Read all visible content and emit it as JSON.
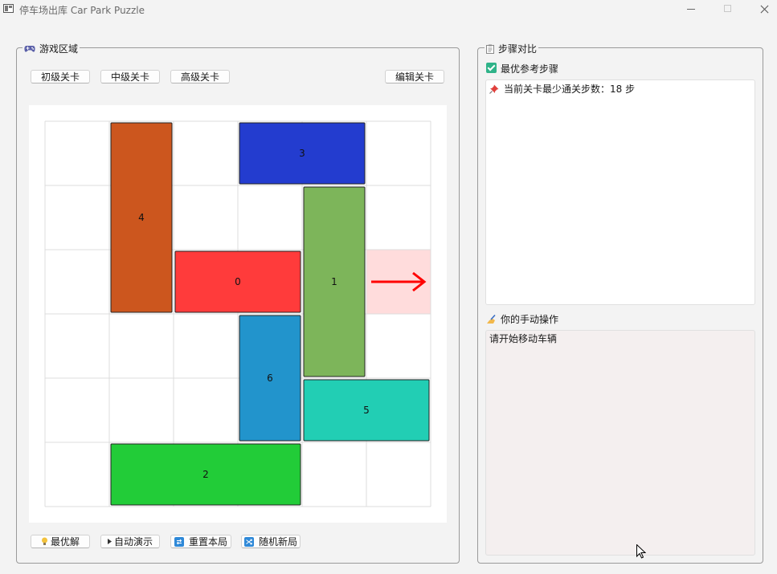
{
  "window": {
    "title": "停车场出库 Car Park Puzzle"
  },
  "game_area": {
    "title": "游戏区域",
    "icon": "gamepad-icon",
    "level_buttons": [
      "初级关卡",
      "中级关卡",
      "高级关卡"
    ],
    "edit_button": "编辑关卡",
    "board": {
      "rows": 6,
      "cols": 6,
      "exit": {
        "row": 2,
        "col": 5,
        "direction": "right",
        "color": "#ff0000",
        "highlight": "#ffdcdc"
      },
      "vehicles": [
        {
          "id": "0",
          "row": 2,
          "col": 2,
          "length": 2,
          "orientation": "horizontal",
          "color": "#ff3b3b"
        },
        {
          "id": "1",
          "row": 1,
          "col": 4,
          "length": 3,
          "orientation": "vertical",
          "color": "#7db55a"
        },
        {
          "id": "2",
          "row": 5,
          "col": 1,
          "length": 3,
          "orientation": "horizontal",
          "color": "#22cc38"
        },
        {
          "id": "3",
          "row": 0,
          "col": 3,
          "length": 2,
          "orientation": "horizontal",
          "color": "#233ccf"
        },
        {
          "id": "4",
          "row": 0,
          "col": 1,
          "length": 3,
          "orientation": "vertical",
          "color": "#cc561e"
        },
        {
          "id": "5",
          "row": 4,
          "col": 4,
          "length": 2,
          "orientation": "horizontal",
          "color": "#22ceb4"
        },
        {
          "id": "6",
          "row": 3,
          "col": 3,
          "length": 2,
          "orientation": "vertical",
          "color": "#2294cc"
        }
      ]
    },
    "action_buttons": [
      {
        "label": "最优解",
        "icon": "lightbulb-icon"
      },
      {
        "label": "自动演示",
        "icon": "play-icon"
      },
      {
        "label": "重置本局",
        "icon": "reset-icon"
      },
      {
        "label": "随机新局",
        "icon": "shuffle-icon"
      }
    ]
  },
  "steps_panel": {
    "title": "步骤对比",
    "icon": "clipboard-icon",
    "best_steps_checkbox": {
      "label": "最优参考步骤",
      "checked": true
    },
    "best_steps_text": "当前关卡最少通关步数：18 步",
    "best_steps_icon": "pin-icon",
    "manual_label": "你的手动操作",
    "manual_icon": "writing-hand-icon",
    "manual_text": "请开始移动车辆"
  },
  "colors": {
    "accent_checkbox": "#2fb389",
    "manual_box_bg": "#f4efef"
  }
}
